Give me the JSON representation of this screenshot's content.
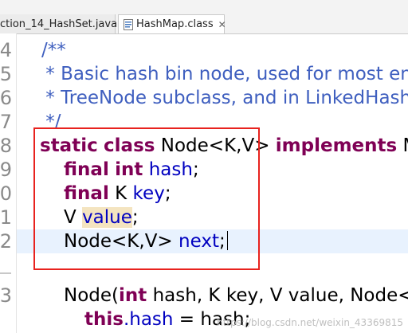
{
  "tabs": [
    {
      "label": "ction_14_HashSet.java",
      "close": "✕",
      "active": false
    },
    {
      "label": "HashMap.class",
      "close": "✕",
      "active": true
    }
  ],
  "gutter": {
    "line_numbers": [
      "4",
      "5",
      "6",
      "7",
      "8",
      "9",
      "0",
      "1",
      "2",
      "",
      "3"
    ]
  },
  "code": {
    "comment_open": "/**",
    "comment_line1": " * Basic hash bin node, used for most ent",
    "comment_line2": " * TreeNode subclass, and in LinkedHash",
    "comment_close": " */",
    "decl_static": "static",
    "decl_class": "class",
    "decl_name": "Node<K,V>",
    "decl_implements": "implements",
    "decl_ma": "Ma",
    "f1_final": "final",
    "f1_int": "int",
    "f1_name": "hash",
    "f1_semi": ";",
    "f2_final": "final",
    "f2_type": "K",
    "f2_name": "key",
    "f2_semi": ";",
    "f3_type": "V",
    "f3_name": "value",
    "f3_semi": ";",
    "f4_type": "Node<K,V>",
    "f4_name": "next",
    "f4_semi": ";",
    "ctor_name": "Node(",
    "ctor_int": "int",
    "ctor_p1": "hash",
    "ctor_sep1": ", K",
    "ctor_p2": "key",
    "ctor_sep2": ", V",
    "ctor_p3": "value",
    "ctor_sep3": ", Node<",
    "this_kw": "this",
    "this_field": ".hash",
    "this_rest": " = hash;"
  },
  "watermark": "https://blog.csdn.net/weixin_43369815"
}
